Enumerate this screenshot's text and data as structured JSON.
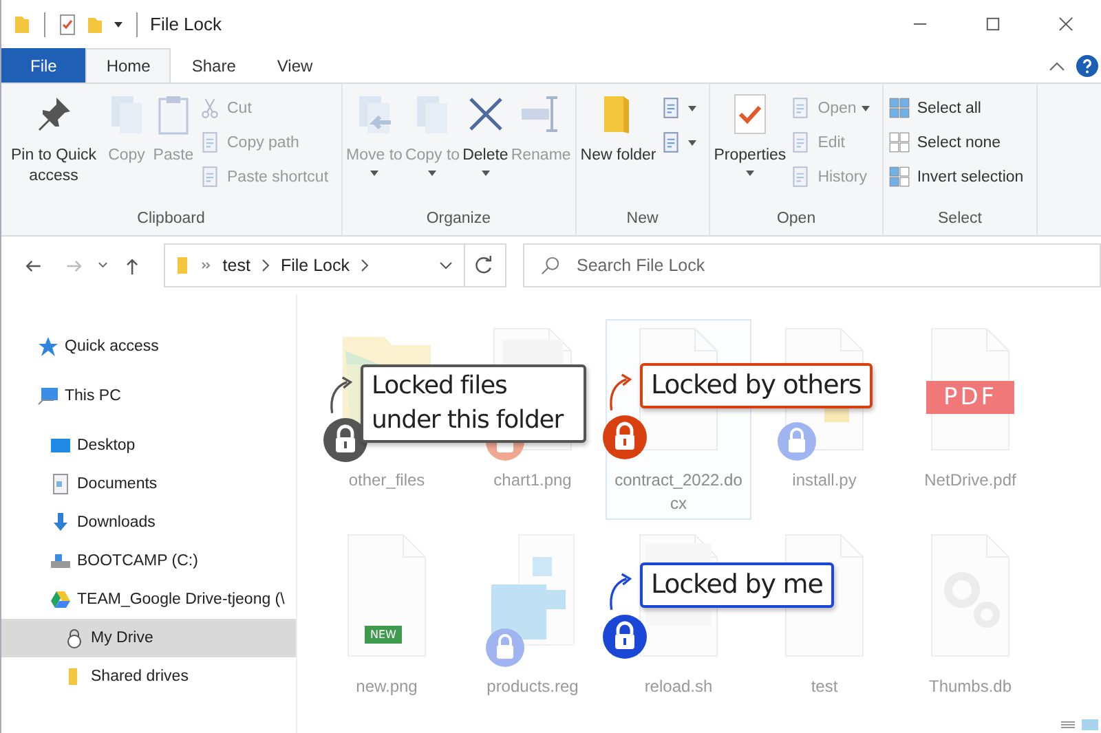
{
  "window": {
    "title": "File Lock"
  },
  "ribbon_tabs": [
    {
      "label": "File",
      "kind": "menu",
      "selected": false
    },
    {
      "label": "Home",
      "kind": "tab",
      "selected": true
    },
    {
      "label": "Share",
      "kind": "tab",
      "selected": false
    },
    {
      "label": "View",
      "kind": "tab",
      "selected": false
    }
  ],
  "ribbon": {
    "groups": [
      {
        "label": "Clipboard",
        "items": [
          {
            "label": "Pin to Quick access",
            "kind": "large",
            "disabled": false,
            "dropdown": false
          },
          {
            "label": "Copy",
            "kind": "large",
            "disabled": true,
            "dropdown": false
          },
          {
            "label": "Paste",
            "kind": "large",
            "disabled": true,
            "dropdown": false
          },
          {
            "label": "Cut",
            "kind": "small",
            "disabled": true,
            "dropdown": false
          },
          {
            "label": "Copy path",
            "kind": "small",
            "disabled": true,
            "dropdown": false
          },
          {
            "label": "Paste shortcut",
            "kind": "small",
            "disabled": true,
            "dropdown": false
          }
        ]
      },
      {
        "label": "Organize",
        "items": [
          {
            "label": "Move to",
            "kind": "large",
            "disabled": true,
            "dropdown": true
          },
          {
            "label": "Copy to",
            "kind": "large",
            "disabled": true,
            "dropdown": true
          },
          {
            "label": "Delete",
            "kind": "large",
            "disabled": false,
            "dropdown": true
          },
          {
            "label": "Rename",
            "kind": "large",
            "disabled": true,
            "dropdown": false
          }
        ]
      },
      {
        "label": "New",
        "items": [
          {
            "label": "New folder",
            "kind": "large",
            "disabled": false,
            "dropdown": false
          },
          {
            "kind": "icon",
            "disabled": false,
            "dropdown": true
          },
          {
            "kind": "icon",
            "disabled": false,
            "dropdown": true
          }
        ]
      },
      {
        "label": "Open",
        "items": [
          {
            "label": "Properties",
            "kind": "large",
            "disabled": false,
            "dropdown": true
          },
          {
            "label": "Open",
            "kind": "small",
            "disabled": true,
            "dropdown": true
          },
          {
            "label": "Edit",
            "kind": "small",
            "disabled": true,
            "dropdown": false
          },
          {
            "label": "History",
            "kind": "small",
            "disabled": true,
            "dropdown": false
          }
        ]
      },
      {
        "label": "Select",
        "items": [
          {
            "label": "Select all",
            "kind": "small",
            "disabled": false,
            "dropdown": false
          },
          {
            "label": "Select none",
            "kind": "small",
            "disabled": false,
            "dropdown": false
          },
          {
            "label": "Invert selection",
            "kind": "small",
            "disabled": false,
            "dropdown": false
          }
        ]
      }
    ]
  },
  "address_bar": {
    "crumbs": [
      "test",
      "File Lock"
    ]
  },
  "search": {
    "placeholder": "Search File Lock"
  },
  "nav_pane": {
    "items": [
      {
        "label": "Quick access",
        "selected": false
      },
      {
        "label": "This PC",
        "selected": false,
        "children": [
          {
            "label": "Desktop",
            "selected": false
          },
          {
            "label": "Documents",
            "selected": false
          },
          {
            "label": "Downloads",
            "selected": false
          },
          {
            "label": "BOOTCAMP (C:)",
            "selected": false
          },
          {
            "label": "TEAM_Google Drive-tjeong (\\",
            "selected": false,
            "children": [
              {
                "label": "My Drive",
                "selected": true
              },
              {
                "label": "Shared drives",
                "selected": false
              }
            ]
          }
        ]
      }
    ]
  },
  "files": [
    {
      "name": "other_files",
      "kind": "folder",
      "selected": false,
      "locked": false
    },
    {
      "name": "chart1.png",
      "kind": "chart",
      "selected": false,
      "locked": true,
      "color": "#f0a890"
    },
    {
      "name": "contract_2022.docx",
      "kind": "document",
      "selected": true,
      "locked": false
    },
    {
      "name": "install.py",
      "kind": "python",
      "selected": false,
      "locked": true,
      "color": "#9fb4f0"
    },
    {
      "name": "NetDrive.pdf",
      "kind": "pdf",
      "badge": "PDF",
      "selected": false,
      "locked": false
    },
    {
      "name": "new.png",
      "kind": "image",
      "badge": "NEW",
      "selected": false,
      "locked": false
    },
    {
      "name": "products.reg",
      "kind": "registry",
      "selected": false,
      "locked": true,
      "color": "#9fb4f0"
    },
    {
      "name": "reload.sh",
      "kind": "script",
      "selected": false,
      "locked": false
    },
    {
      "name": "test",
      "kind": "blank",
      "selected": false,
      "locked": false
    },
    {
      "name": "Thumbs.db",
      "kind": "gears",
      "selected": false,
      "locked": false
    }
  ],
  "callouts": [
    {
      "text": "Locked files under this folder",
      "kind": "folder",
      "color": "#555555"
    },
    {
      "text": "Locked by others",
      "kind": "others",
      "color": "#d9400f"
    },
    {
      "text": "Locked by me",
      "kind": "me",
      "color": "#1a47d6"
    }
  ]
}
